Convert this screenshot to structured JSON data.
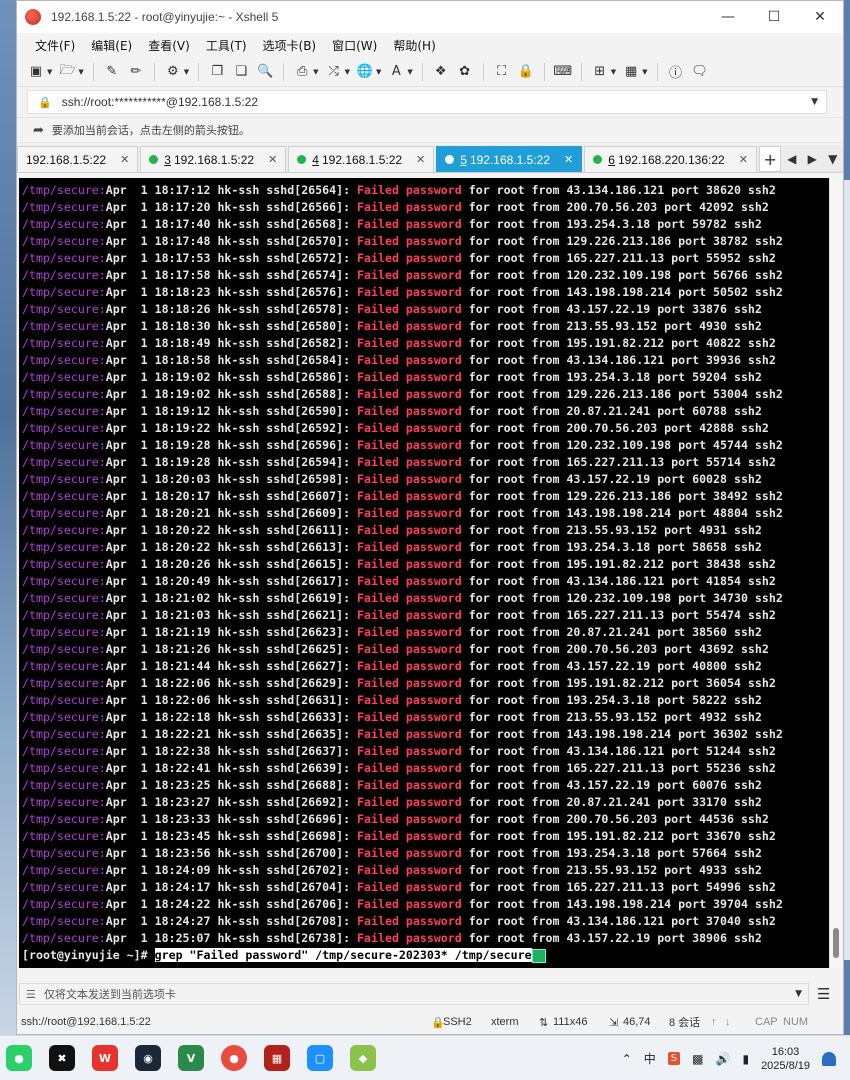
{
  "window": {
    "title": "192.168.1.5:22 - root@yinyujie:~ - Xshell 5"
  },
  "menu": [
    "文件(F)",
    "编辑(E)",
    "查看(V)",
    "工具(T)",
    "选项卡(B)",
    "窗口(W)",
    "帮助(H)"
  ],
  "address": "ssh://root:***********@192.168.1.5:22",
  "hint": "要添加当前会话，点击左侧的箭头按钮。",
  "tabs": [
    {
      "num": "",
      "label": "192.168.1.5:22",
      "active": false
    },
    {
      "num": "3",
      "label": "192.168.1.5:22",
      "active": false
    },
    {
      "num": "4",
      "label": "192.168.1.5:22",
      "active": false
    },
    {
      "num": "5",
      "label": "192.168.1.5:22",
      "active": true
    },
    {
      "num": "6",
      "label": "192.168.220.136:22",
      "active": false
    }
  ],
  "terminal": {
    "path_prefix": "/tmp/secure:",
    "fail_word": "Failed password",
    "lines": [
      [
        "Apr  1 18:17:12 hk-ssh sshd[26564]: ",
        " for root from 43.134.186.121 port 38620 ssh2"
      ],
      [
        "Apr  1 18:17:20 hk-ssh sshd[26566]: ",
        " for root from 200.70.56.203 port 42092 ssh2"
      ],
      [
        "Apr  1 18:17:40 hk-ssh sshd[26568]: ",
        " for root from 193.254.3.18 port 59782 ssh2"
      ],
      [
        "Apr  1 18:17:48 hk-ssh sshd[26570]: ",
        " for root from 129.226.213.186 port 38782 ssh2"
      ],
      [
        "Apr  1 18:17:53 hk-ssh sshd[26572]: ",
        " for root from 165.227.211.13 port 55952 ssh2"
      ],
      [
        "Apr  1 18:17:58 hk-ssh sshd[26574]: ",
        " for root from 120.232.109.198 port 56766 ssh2"
      ],
      [
        "Apr  1 18:18:23 hk-ssh sshd[26576]: ",
        " for root from 143.198.198.214 port 50502 ssh2"
      ],
      [
        "Apr  1 18:18:26 hk-ssh sshd[26578]: ",
        " for root from 43.157.22.19 port 33876 ssh2"
      ],
      [
        "Apr  1 18:18:30 hk-ssh sshd[26580]: ",
        " for root from 213.55.93.152 port 4930 ssh2"
      ],
      [
        "Apr  1 18:18:49 hk-ssh sshd[26582]: ",
        " for root from 195.191.82.212 port 40822 ssh2"
      ],
      [
        "Apr  1 18:18:58 hk-ssh sshd[26584]: ",
        " for root from 43.134.186.121 port 39936 ssh2"
      ],
      [
        "Apr  1 18:19:02 hk-ssh sshd[26586]: ",
        " for root from 193.254.3.18 port 59204 ssh2"
      ],
      [
        "Apr  1 18:19:02 hk-ssh sshd[26588]: ",
        " for root from 129.226.213.186 port 53004 ssh2"
      ],
      [
        "Apr  1 18:19:12 hk-ssh sshd[26590]: ",
        " for root from 20.87.21.241 port 60788 ssh2"
      ],
      [
        "Apr  1 18:19:22 hk-ssh sshd[26592]: ",
        " for root from 200.70.56.203 port 42888 ssh2"
      ],
      [
        "Apr  1 18:19:28 hk-ssh sshd[26596]: ",
        " for root from 120.232.109.198 port 45744 ssh2"
      ],
      [
        "Apr  1 18:19:28 hk-ssh sshd[26594]: ",
        " for root from 165.227.211.13 port 55714 ssh2"
      ],
      [
        "Apr  1 18:20:03 hk-ssh sshd[26598]: ",
        " for root from 43.157.22.19 port 60028 ssh2"
      ],
      [
        "Apr  1 18:20:17 hk-ssh sshd[26607]: ",
        " for root from 129.226.213.186 port 38492 ssh2"
      ],
      [
        "Apr  1 18:20:21 hk-ssh sshd[26609]: ",
        " for root from 143.198.198.214 port 48804 ssh2"
      ],
      [
        "Apr  1 18:20:22 hk-ssh sshd[26611]: ",
        " for root from 213.55.93.152 port 4931 ssh2"
      ],
      [
        "Apr  1 18:20:22 hk-ssh sshd[26613]: ",
        " for root from 193.254.3.18 port 58658 ssh2"
      ],
      [
        "Apr  1 18:20:26 hk-ssh sshd[26615]: ",
        " for root from 195.191.82.212 port 38438 ssh2"
      ],
      [
        "Apr  1 18:20:49 hk-ssh sshd[26617]: ",
        " for root from 43.134.186.121 port 41854 ssh2"
      ],
      [
        "Apr  1 18:21:02 hk-ssh sshd[26619]: ",
        " for root from 120.232.109.198 port 34730 ssh2"
      ],
      [
        "Apr  1 18:21:03 hk-ssh sshd[26621]: ",
        " for root from 165.227.211.13 port 55474 ssh2"
      ],
      [
        "Apr  1 18:21:19 hk-ssh sshd[26623]: ",
        " for root from 20.87.21.241 port 38560 ssh2"
      ],
      [
        "Apr  1 18:21:26 hk-ssh sshd[26625]: ",
        " for root from 200.70.56.203 port 43692 ssh2"
      ],
      [
        "Apr  1 18:21:44 hk-ssh sshd[26627]: ",
        " for root from 43.157.22.19 port 40800 ssh2"
      ],
      [
        "Apr  1 18:22:06 hk-ssh sshd[26629]: ",
        " for root from 195.191.82.212 port 36054 ssh2"
      ],
      [
        "Apr  1 18:22:06 hk-ssh sshd[26631]: ",
        " for root from 193.254.3.18 port 58222 ssh2"
      ],
      [
        "Apr  1 18:22:18 hk-ssh sshd[26633]: ",
        " for root from 213.55.93.152 port 4932 ssh2"
      ],
      [
        "Apr  1 18:22:21 hk-ssh sshd[26635]: ",
        " for root from 143.198.198.214 port 36302 ssh2"
      ],
      [
        "Apr  1 18:22:38 hk-ssh sshd[26637]: ",
        " for root from 43.134.186.121 port 51244 ssh2"
      ],
      [
        "Apr  1 18:22:41 hk-ssh sshd[26639]: ",
        " for root from 165.227.211.13 port 55236 ssh2"
      ],
      [
        "Apr  1 18:23:25 hk-ssh sshd[26688]: ",
        " for root from 43.157.22.19 port 60076 ssh2"
      ],
      [
        "Apr  1 18:23:27 hk-ssh sshd[26692]: ",
        " for root from 20.87.21.241 port 33170 ssh2"
      ],
      [
        "Apr  1 18:23:33 hk-ssh sshd[26696]: ",
        " for root from 200.70.56.203 port 44536 ssh2"
      ],
      [
        "Apr  1 18:23:45 hk-ssh sshd[26698]: ",
        " for root from 195.191.82.212 port 33670 ssh2"
      ],
      [
        "Apr  1 18:23:56 hk-ssh sshd[26700]: ",
        " for root from 193.254.3.18 port 57664 ssh2"
      ],
      [
        "Apr  1 18:24:09 hk-ssh sshd[26702]: ",
        " for root from 213.55.93.152 port 4933 ssh2"
      ],
      [
        "Apr  1 18:24:17 hk-ssh sshd[26704]: ",
        " for root from 165.227.211.13 port 54996 ssh2"
      ],
      [
        "Apr  1 18:24:22 hk-ssh sshd[26706]: ",
        " for root from 143.198.198.214 port 39704 ssh2"
      ],
      [
        "Apr  1 18:24:27 hk-ssh sshd[26708]: ",
        " for root from 43.134.186.121 port 37040 ssh2"
      ],
      [
        "Apr  1 18:25:07 hk-ssh sshd[26738]: ",
        " for root from 43.157.22.19 port 38906 ssh2"
      ]
    ],
    "prompt": "[root@yinyujie ~]# ",
    "command": "grep \"Failed password\" /tmp/secure-202303* /tmp/secure"
  },
  "sendbar": {
    "placeholder": "仅将文本发送到当前选项卡"
  },
  "status": {
    "connection": "ssh://root@192.168.1.5:22",
    "protocol": "SSH2",
    "term": "xterm",
    "size": "111x46",
    "cursor": "46,74",
    "sessions": "8 会话",
    "caps": "CAP",
    "num": "NUM"
  },
  "taskbar": {
    "time": "16:03",
    "date": "2025/8/19",
    "ime": "中",
    "tray_app": "S"
  }
}
